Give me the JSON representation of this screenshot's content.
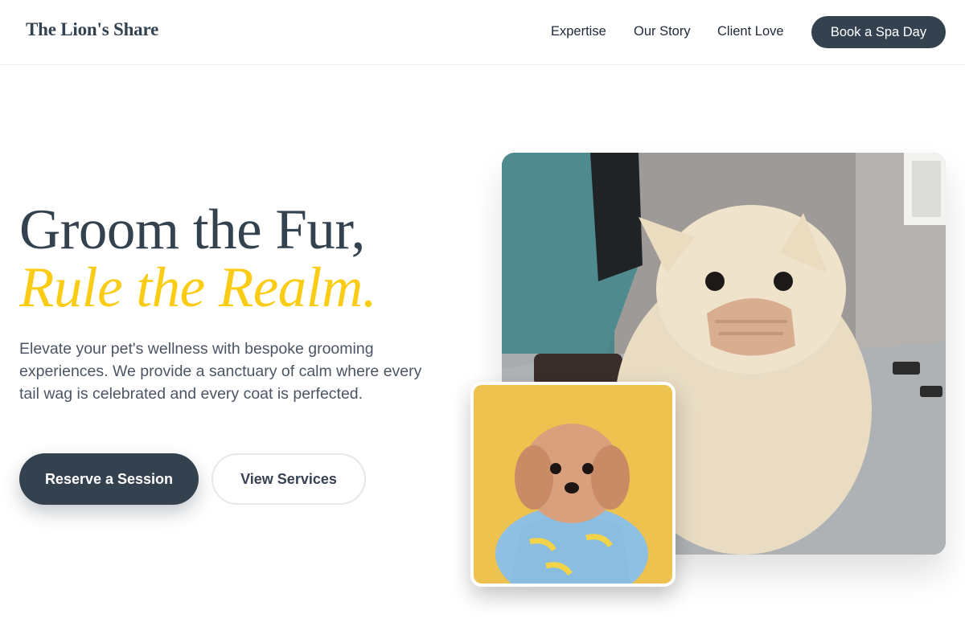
{
  "nav": {
    "brand": "The Lion's Share",
    "links": [
      "Expertise",
      "Our Story",
      "Client Love"
    ],
    "cta": "Book a Spa Day"
  },
  "hero": {
    "headline_line1": "Groom the Fur,",
    "headline_line2": "Rule the Realm.",
    "lead": "Elevate your pet's wellness with bespoke grooming experiences. We provide a sanctuary of calm where every tail wag is celebrated and every coat is perfected.",
    "primary_cta": "Reserve a Session",
    "secondary_cta": "View Services"
  },
  "images": {
    "main_alt": "Fluffy cream dog wearing a muzzle during grooming",
    "inset_alt": "Small fluffy dog in a blue shirt on a yellow background"
  },
  "colors": {
    "primary": "#344250",
    "accent": "#facc15",
    "text": "#4b5563"
  }
}
